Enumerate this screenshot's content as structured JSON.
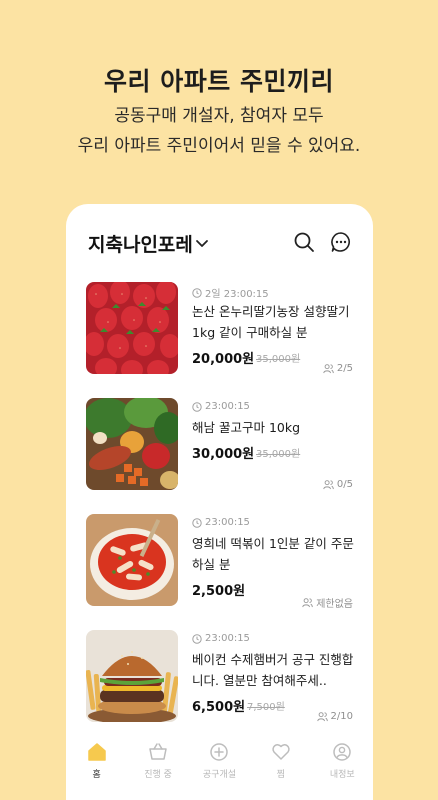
{
  "promo": {
    "headline": "우리 아파트 주민끼리",
    "line1": "공동구매 개설자, 참여자 모두",
    "line2": "우리 아파트 주민이어서 믿을 수 있어요."
  },
  "header": {
    "store_name": "지축나인포레",
    "icons": [
      "chevron-down-icon",
      "search-icon",
      "chat-icon"
    ]
  },
  "items": [
    {
      "time": "2일 23:00:15",
      "title": "논산 온누리딸기농장 설향딸기 1kg 같이 구매하실 분",
      "price": "20,000원",
      "original_price": "35,000원",
      "participants": "2/5",
      "image": "strawberries"
    },
    {
      "time": "23:00:15",
      "title": "해남 꿀고구마 10kg",
      "price": "30,000원",
      "original_price": "35,000원",
      "participants": "0/5",
      "image": "vegetables"
    },
    {
      "time": "23:00:15",
      "title": "영희네 떡볶이 1인분 같이 주문하실 분",
      "price": "2,500원",
      "original_price": "",
      "participants": "제한없음",
      "image": "tteokbokki"
    },
    {
      "time": "23:00:15",
      "title": "베이컨 수제햄버거 공구 진행합니다. 열분만 참여해주세..",
      "price": "6,500원",
      "original_price": "7,500원",
      "participants": "2/10",
      "image": "burger"
    }
  ],
  "tabs": [
    {
      "label": "홈",
      "icon": "home-icon",
      "active": true
    },
    {
      "label": "진행 중",
      "icon": "basket-icon",
      "active": false
    },
    {
      "label": "공구개설",
      "icon": "plus-circle-icon",
      "active": false
    },
    {
      "label": "찜",
      "icon": "heart-icon",
      "active": false
    },
    {
      "label": "내정보",
      "icon": "user-icon",
      "active": false
    }
  ],
  "colors": {
    "background": "#FCE3A3",
    "accent": "#F6C94E",
    "card": "#FFFFFF"
  }
}
